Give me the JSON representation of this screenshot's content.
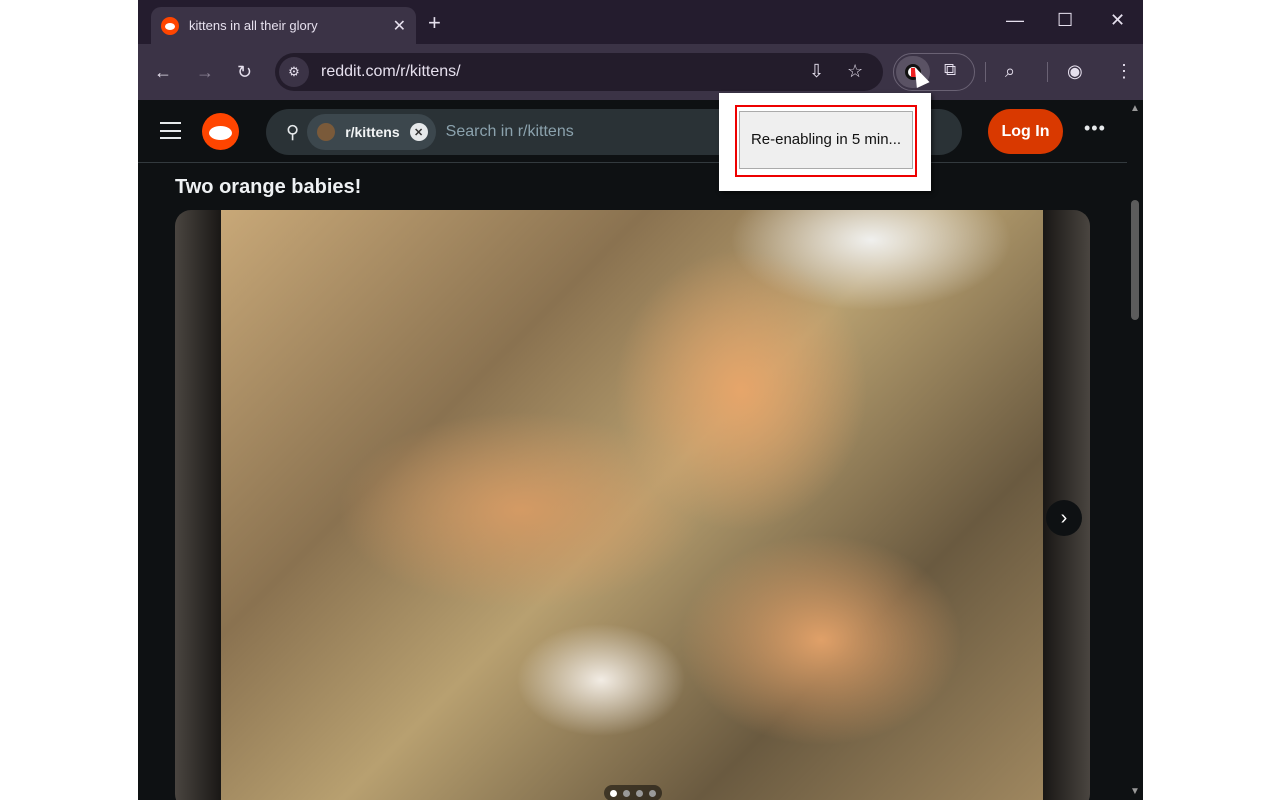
{
  "browser": {
    "tab_title": "kittens in all their glory",
    "url": "reddit.com/r/kittens/",
    "new_tab": "+",
    "tab_close": "✕",
    "window": {
      "minimize": "—",
      "maximize": "☐",
      "close": "✕"
    },
    "nav": {
      "back": "←",
      "forward": "→",
      "reload": "↻"
    }
  },
  "reddit": {
    "subreddit_chip": "r/kittens",
    "search_placeholder": "Search in r/kittens",
    "login": "Log In",
    "more": "•••"
  },
  "post": {
    "title": "Two orange babies!",
    "gallery_count": 4,
    "gallery_current": 1,
    "next": "›"
  },
  "popup": {
    "button": "Re-enabling in 5 min..."
  },
  "colors": {
    "accent": "#d93900",
    "brand": "#ff4500"
  }
}
